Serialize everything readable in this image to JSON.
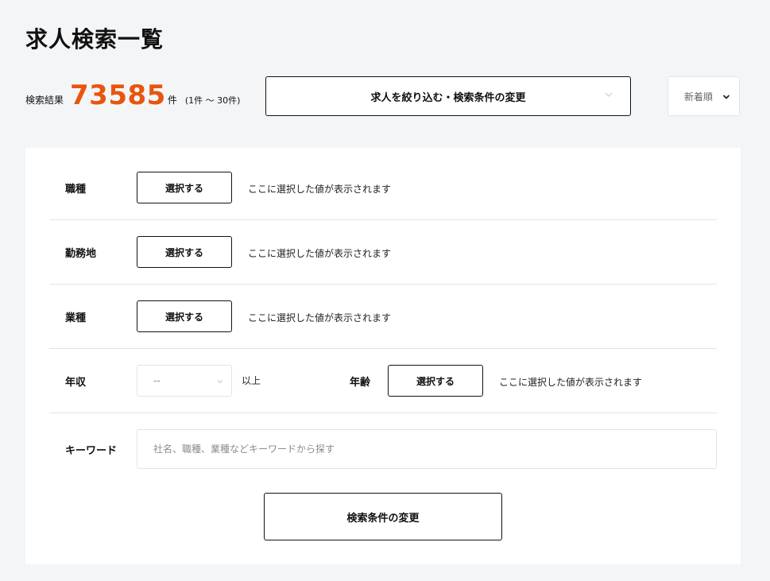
{
  "page": {
    "title": "求人検索一覧"
  },
  "summary": {
    "label": "検索結果",
    "count": "73585",
    "unit": "件",
    "range": "(1件 ～ 30件)"
  },
  "filter_toggle": {
    "label": "求人を絞り込む・検索条件の変更",
    "icon": "chevron-down-icon"
  },
  "sort": {
    "selected": "新着順",
    "icon": "chevron-down-icon"
  },
  "filters": {
    "occupation": {
      "label": "職種",
      "button": "選択する",
      "hint": "ここに選択した値が表示されます"
    },
    "location": {
      "label": "勤務地",
      "button": "選択する",
      "hint": "ここに選択した値が表示されます"
    },
    "industry": {
      "label": "業種",
      "button": "選択する",
      "hint": "ここに選択した値が表示されます"
    },
    "income": {
      "label": "年収",
      "selected": "--",
      "suffix": "以上"
    },
    "age": {
      "label": "年齢",
      "button": "選択する",
      "hint": "ここに選択した値が表示されます"
    },
    "keyword": {
      "label": "キーワード",
      "value": "",
      "placeholder": "社名、職種、業種などキーワードから探す"
    }
  },
  "submit": {
    "label": "検索条件の変更"
  },
  "colors": {
    "accent": "#e8550e",
    "border": "#111111",
    "background": "#f4f5f7"
  }
}
